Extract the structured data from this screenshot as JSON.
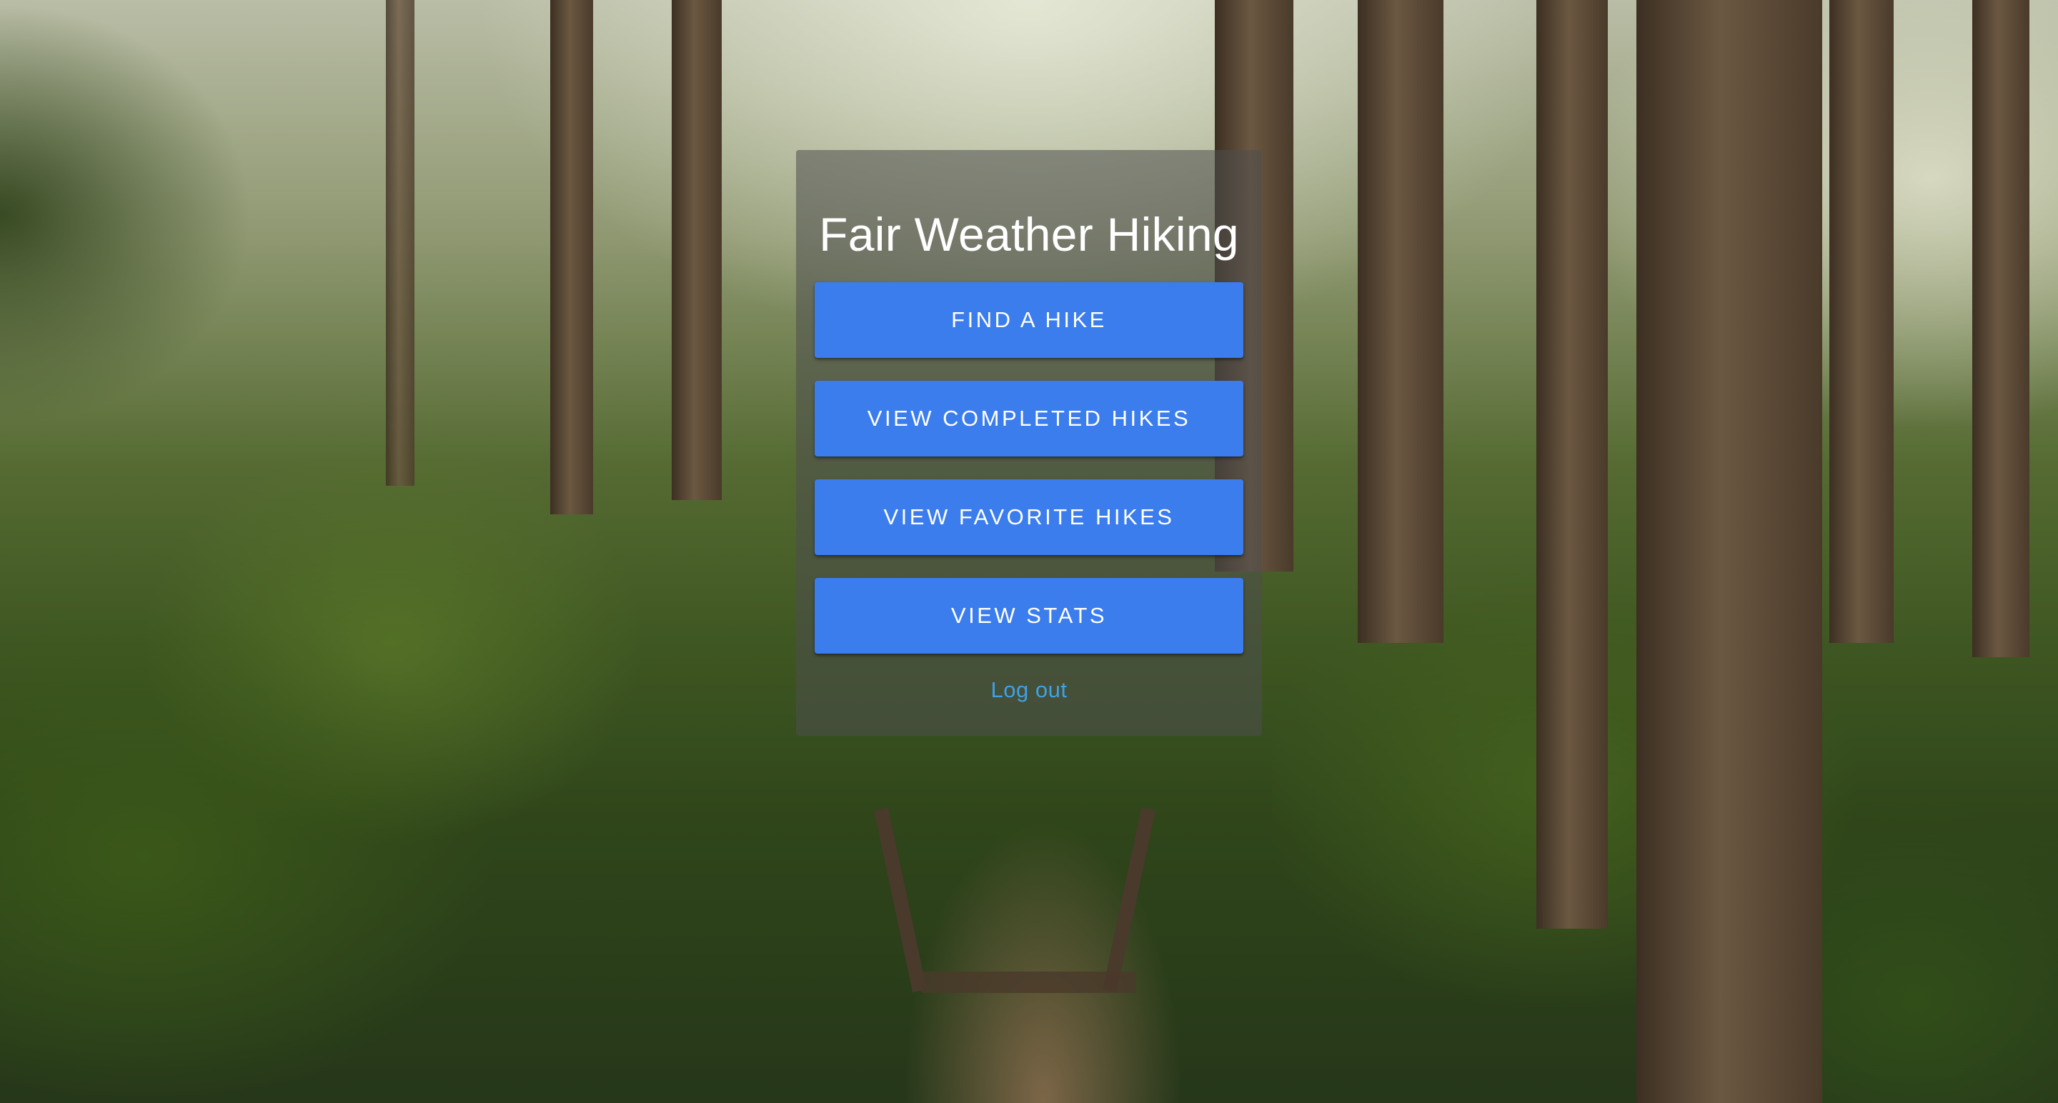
{
  "app": {
    "title": "Fair Weather Hiking"
  },
  "menu": {
    "buttons": [
      {
        "label": "FIND A HIKE"
      },
      {
        "label": "VIEW COMPLETED HIKES"
      },
      {
        "label": "VIEW FAVORITE HIKES"
      },
      {
        "label": "VIEW STATS"
      }
    ],
    "logout_label": "Log out"
  },
  "background": {
    "kind": "forest-photo"
  },
  "colors": {
    "button_bg": "#3b7ded",
    "button_text": "#ffffff",
    "link": "#3fa1e6",
    "card_overlay": "rgba(78,78,78,0.55)"
  }
}
